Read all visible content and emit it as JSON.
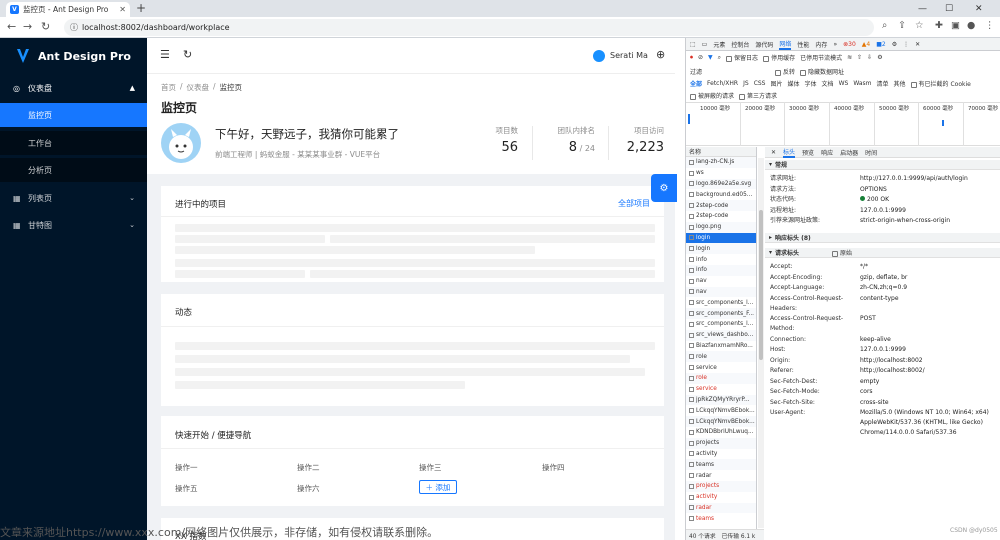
{
  "browser": {
    "tab_title": "监控页 - Ant Design Pro",
    "url": "localhost:8002/dashboard/workplace"
  },
  "sidebar": {
    "brand": "Ant Design Pro",
    "items": [
      {
        "label": "仪表盘",
        "icon": "dashboard-icon"
      },
      {
        "label": "监控页"
      },
      {
        "label": "工作台"
      },
      {
        "label": "分析页"
      },
      {
        "label": "列表页",
        "icon": "table-icon"
      },
      {
        "label": "甘特图",
        "icon": "table-icon"
      }
    ]
  },
  "header": {
    "user_name": "Serati Ma"
  },
  "page": {
    "breadcrumb": [
      "首页",
      "仪表盘",
      "监控页"
    ],
    "title": "监控页",
    "greeting": "下午好，天野远子，我猜你可能累了",
    "role": "前端工程师 | 蚂蚁金服 - 某某某事业群 - VUE平台",
    "stats": [
      {
        "label": "项目数",
        "value": "56"
      },
      {
        "label": "团队内排名",
        "value": "8",
        "suffix": " / 24"
      },
      {
        "label": "项目访问",
        "value": "2,223"
      }
    ],
    "projects_title": "进行中的项目",
    "projects_link": "全部项目",
    "activity_title": "动态",
    "quicknav_title": "快速开始 / 便捷导航",
    "ops": [
      "操作一",
      "操作二",
      "操作三",
      "操作四",
      "操作五",
      "操作六"
    ],
    "add_label": "＋ 添加",
    "index_title": "XX 指数"
  },
  "watermark": "文章来源地址https://www.xxx.com/网络图片仅供展示，非存储，如有侵权请联系删除。",
  "devtools": {
    "tabs": [
      "元素",
      "控制台",
      "源代码",
      "网络",
      "性能",
      "内存"
    ],
    "badges": {
      "errors": "30",
      "warnings": "4",
      "info": "2"
    },
    "toolbar": [
      "保留日志",
      "停用缓存",
      "已停用节流模式"
    ],
    "filter_label": "过滤",
    "filter_opts": [
      "反转",
      "隐藏数据网址"
    ],
    "types": [
      "全部",
      "Fetch/XHR",
      "JS",
      "CSS",
      "图片",
      "媒体",
      "字体",
      "文档",
      "WS",
      "Wasm",
      "清单",
      "其他"
    ],
    "extra_filter": "有已拦截的 Cookie",
    "blocked": [
      "被屏蔽的请求",
      "第三方请求"
    ],
    "ticks": [
      "10000 毫秒",
      "20000 毫秒",
      "30000 毫秒",
      "40000 毫秒",
      "50000 毫秒",
      "60000 毫秒",
      "70000 毫秒"
    ],
    "list_header": "名称",
    "requests": [
      {
        "name": "lang-zh-CN.js",
        "red": false
      },
      {
        "name": "ws",
        "red": false
      },
      {
        "name": "logo.869e2a5e.svg",
        "red": false
      },
      {
        "name": "background.ed05...",
        "red": false
      },
      {
        "name": "2step-code",
        "red": false
      },
      {
        "name": "2step-code",
        "red": false
      },
      {
        "name": "logo.png",
        "red": false
      },
      {
        "name": "login",
        "red": false,
        "selected": true
      },
      {
        "name": "login",
        "red": false
      },
      {
        "name": "info",
        "red": false
      },
      {
        "name": "info",
        "red": false
      },
      {
        "name": "nav",
        "red": false
      },
      {
        "name": "nav",
        "red": false
      },
      {
        "name": "src_components_l...",
        "red": false
      },
      {
        "name": "src_components_F...",
        "red": false
      },
      {
        "name": "src_components_l...",
        "red": false
      },
      {
        "name": "src_views_dashbo...",
        "red": false
      },
      {
        "name": "BiazfanxmamNRo...",
        "red": false
      },
      {
        "name": "role",
        "red": false
      },
      {
        "name": "service",
        "red": false
      },
      {
        "name": "role",
        "red": true
      },
      {
        "name": "service",
        "red": true
      },
      {
        "name": "jpRkZQMyYRryrP...",
        "red": false
      },
      {
        "name": "LCkqqYNmvBEbok...",
        "red": false
      },
      {
        "name": "LCkqqYNmvBEbok...",
        "red": false
      },
      {
        "name": "KDNDBbriUhLwuq...",
        "red": false
      },
      {
        "name": "projects",
        "red": false
      },
      {
        "name": "activity",
        "red": false
      },
      {
        "name": "teams",
        "red": false
      },
      {
        "name": "radar",
        "red": false
      },
      {
        "name": "projects",
        "red": true
      },
      {
        "name": "activity",
        "red": true
      },
      {
        "name": "radar",
        "red": true
      },
      {
        "name": "teams",
        "red": true
      }
    ],
    "footer": [
      "40 个请求",
      "已传输 6.1 k"
    ],
    "detail_tabs": [
      "标头",
      "预览",
      "响应",
      "启动器",
      "时间"
    ],
    "general_title": "常规",
    "general": [
      {
        "k": "请求网址:",
        "v": "http://127.0.0.1:9999/api/auth/login"
      },
      {
        "k": "请求方法:",
        "v": "OPTIONS"
      },
      {
        "k": "状态代码:",
        "v": "200 OK"
      },
      {
        "k": "远程地址:",
        "v": "127.0.0.1:9999"
      },
      {
        "k": "引荐来源网址政策:",
        "v": "strict-origin-when-cross-origin"
      }
    ],
    "response_title": "响应标头 (8)",
    "request_title": "请求标头",
    "raw_label": "原始",
    "request_headers": [
      {
        "k": "Accept:",
        "v": "*/*"
      },
      {
        "k": "Accept-Encoding:",
        "v": "gzip, deflate, br"
      },
      {
        "k": "Accept-Language:",
        "v": "zh-CN,zh;q=0.9"
      },
      {
        "k": "Access-Control-Request-\nHeaders:",
        "v": "content-type"
      },
      {
        "k": "Access-Control-Request-\nMethod:",
        "v": "POST"
      },
      {
        "k": "Connection:",
        "v": "keep-alive"
      },
      {
        "k": "Host:",
        "v": "127.0.0.1:9999"
      },
      {
        "k": "Origin:",
        "v": "http://localhost:8002"
      },
      {
        "k": "Referer:",
        "v": "http://localhost:8002/"
      },
      {
        "k": "Sec-Fetch-Dest:",
        "v": "empty"
      },
      {
        "k": "Sec-Fetch-Mode:",
        "v": "cors"
      },
      {
        "k": "Sec-Fetch-Site:",
        "v": "cross-site"
      },
      {
        "k": "User-Agent:",
        "v": "Mozilla/5.0 (Windows NT 10.0; Win64; x64)\nAppleWebKit/537.36 (KHTML, like Gecko)\nChrome/114.0.0.0 Safari/537.36"
      }
    ],
    "credit": "CSDN @dy0505"
  }
}
